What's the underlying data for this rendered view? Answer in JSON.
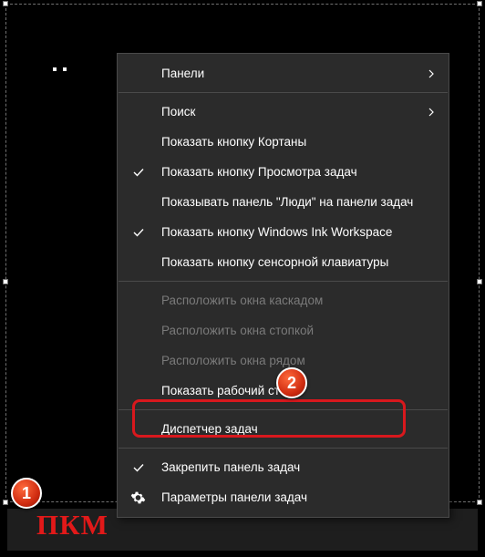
{
  "menu": {
    "items": [
      {
        "label": "Панели",
        "arrow": true
      },
      {
        "separator": true
      },
      {
        "label": "Поиск",
        "arrow": true
      },
      {
        "label": "Показать кнопку Кортаны"
      },
      {
        "label": "Показать кнопку Просмотра задач",
        "checked": true
      },
      {
        "label": "Показывать панель \"Люди\" на панели задач"
      },
      {
        "label": "Показать кнопку Windows Ink Workspace",
        "checked": true
      },
      {
        "label": "Показать кнопку сенсорной клавиатуры"
      },
      {
        "separator": true
      },
      {
        "label": "Расположить окна каскадом",
        "disabled": true
      },
      {
        "label": "Расположить окна стопкой",
        "disabled": true
      },
      {
        "label": "Расположить окна рядом",
        "disabled": true
      },
      {
        "label": "Показать рабочий стол"
      },
      {
        "separator": true
      },
      {
        "label": "Диспетчер задач"
      },
      {
        "separator": true
      },
      {
        "label": "Закрепить панель задач",
        "checked": true
      },
      {
        "label": "Параметры панели задач",
        "gear": true
      }
    ]
  },
  "badges": {
    "one": "1",
    "two": "2"
  },
  "labels": {
    "pkm": "ПКМ"
  }
}
